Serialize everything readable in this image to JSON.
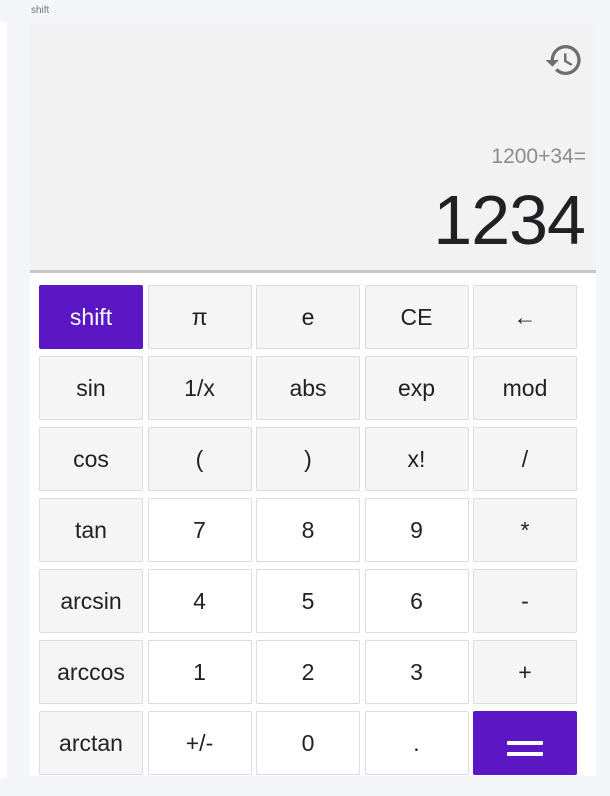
{
  "caption": "shift",
  "display": {
    "expression": "1200+34=",
    "result": "1234",
    "history_icon": "history-icon"
  },
  "keys": [
    {
      "label": "shift",
      "name": "shift-key",
      "style": "active"
    },
    {
      "label": "π",
      "name": "pi-key",
      "style": "fn"
    },
    {
      "label": "e",
      "name": "e-key",
      "style": "fn"
    },
    {
      "label": "CE",
      "name": "clear-entry-key",
      "style": "fn"
    },
    {
      "label": "←",
      "name": "backspace-key",
      "style": "fn"
    },
    {
      "label": "sin",
      "name": "sin-key",
      "style": "fn"
    },
    {
      "label": "1/x",
      "name": "reciprocal-key",
      "style": "fn"
    },
    {
      "label": "abs",
      "name": "abs-key",
      "style": "fn"
    },
    {
      "label": "exp",
      "name": "exp-key",
      "style": "fn"
    },
    {
      "label": "mod",
      "name": "mod-key",
      "style": "fn"
    },
    {
      "label": "cos",
      "name": "cos-key",
      "style": "fn"
    },
    {
      "label": "(",
      "name": "open-paren-key",
      "style": "fn"
    },
    {
      "label": ")",
      "name": "close-paren-key",
      "style": "fn"
    },
    {
      "label": "x!",
      "name": "factorial-key",
      "style": "fn"
    },
    {
      "label": "/",
      "name": "divide-key",
      "style": "fn"
    },
    {
      "label": "tan",
      "name": "tan-key",
      "style": "fn"
    },
    {
      "label": "7",
      "name": "digit-7-key",
      "style": "num"
    },
    {
      "label": "8",
      "name": "digit-8-key",
      "style": "num"
    },
    {
      "label": "9",
      "name": "digit-9-key",
      "style": "num"
    },
    {
      "label": "*",
      "name": "multiply-key",
      "style": "fn"
    },
    {
      "label": "arcsin",
      "name": "arcsin-key",
      "style": "fn"
    },
    {
      "label": "4",
      "name": "digit-4-key",
      "style": "num"
    },
    {
      "label": "5",
      "name": "digit-5-key",
      "style": "num"
    },
    {
      "label": "6",
      "name": "digit-6-key",
      "style": "num"
    },
    {
      "label": "-",
      "name": "subtract-key",
      "style": "fn"
    },
    {
      "label": "arccos",
      "name": "arccos-key",
      "style": "fn"
    },
    {
      "label": "1",
      "name": "digit-1-key",
      "style": "num"
    },
    {
      "label": "2",
      "name": "digit-2-key",
      "style": "num"
    },
    {
      "label": "3",
      "name": "digit-3-key",
      "style": "num"
    },
    {
      "label": "+",
      "name": "add-key",
      "style": "fn"
    },
    {
      "label": "arctan",
      "name": "arctan-key",
      "style": "fn"
    },
    {
      "label": "+/-",
      "name": "negate-key",
      "style": "num"
    },
    {
      "label": "0",
      "name": "digit-0-key",
      "style": "num"
    },
    {
      "label": ".",
      "name": "decimal-key",
      "style": "num"
    },
    {
      "label": "=",
      "name": "equals-key",
      "style": "equals"
    }
  ],
  "colors": {
    "accent": "#5b17c4",
    "display_bg": "#f2f2f2",
    "key_border": "#dcdcdc"
  }
}
